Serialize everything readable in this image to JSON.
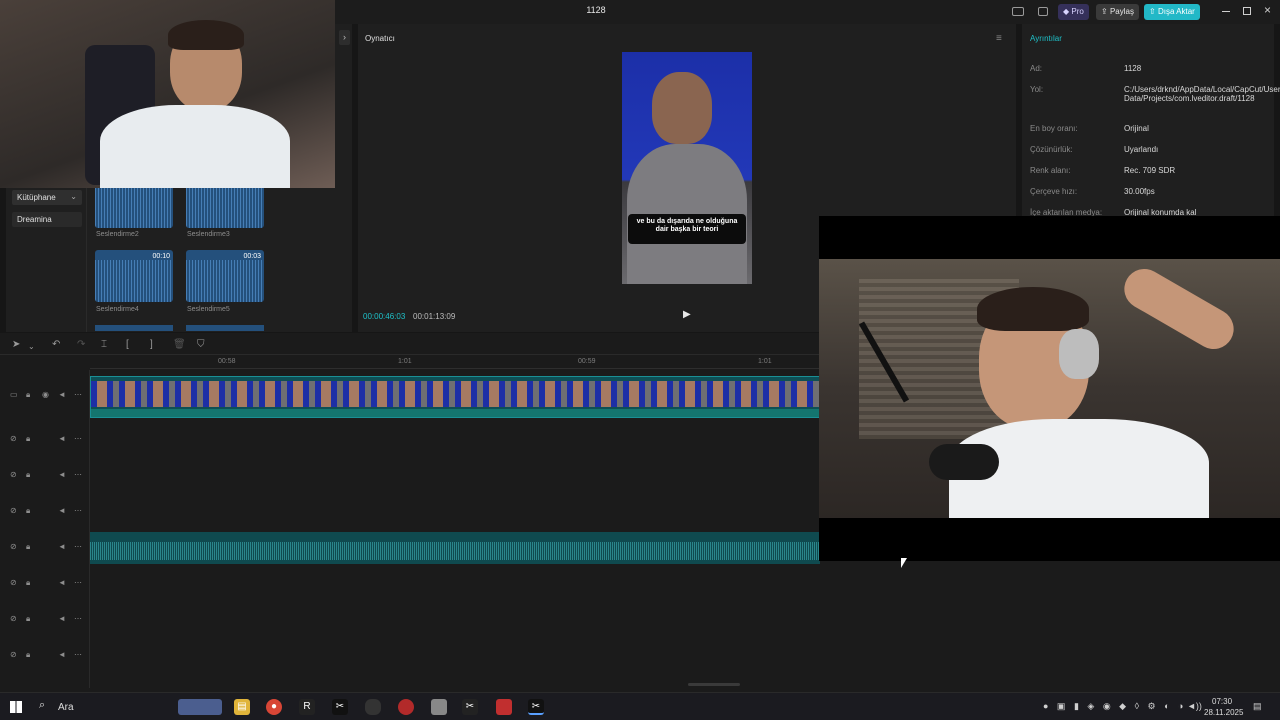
{
  "window": {
    "title": "1128"
  },
  "titlebar": {
    "pro_label": "Pro",
    "share_label": "Paylaş",
    "export_label": "Dışa Aktar"
  },
  "left_panel": {
    "nav": [
      {
        "label": "Kütüphane"
      },
      {
        "label": "Dreamina"
      }
    ],
    "media": [
      {
        "name": "Seslendirme2",
        "duration": ""
      },
      {
        "name": "Seslendirme3",
        "duration": ""
      },
      {
        "name": "Seslendirme4",
        "duration": "00:10"
      },
      {
        "name": "Seslendirme5",
        "duration": "00:03"
      }
    ]
  },
  "player": {
    "title": "Oynatıcı",
    "subtitle": "ve bu da dışarıda ne olduğuna dair başka bir teori",
    "current_time": "00:00:46:03",
    "total_time": "00:01:13:09"
  },
  "details": {
    "title": "Ayrıntılar",
    "rows": [
      {
        "label": "Ad:",
        "value": "1128"
      },
      {
        "label": "Yol:",
        "value": "C:/Users/drknd/AppData/Local/CapCut/User Data/Projects/com.lveditor.draft/1128"
      },
      {
        "label": "En boy oranı:",
        "value": "Orijinal"
      },
      {
        "label": "Çözünürlük:",
        "value": "Uyarlandı"
      },
      {
        "label": "Renk alanı:",
        "value": "Rec. 709 SDR"
      },
      {
        "label": "Çerçeve hızı:",
        "value": "30.00fps"
      },
      {
        "label": "İçe aktarılan medya:",
        "value": "Orijinal konumda kal"
      }
    ]
  },
  "timeline": {
    "ruler": [
      "00:58",
      "1:01",
      "00:59",
      "1:01"
    ]
  },
  "taskbar": {
    "search_label": "Ara",
    "time": "07:30",
    "date": "28.11.2025"
  },
  "colors": {
    "accent": "#1fc1c9",
    "export": "#22b8c7",
    "pro": "#5a4bd1"
  }
}
